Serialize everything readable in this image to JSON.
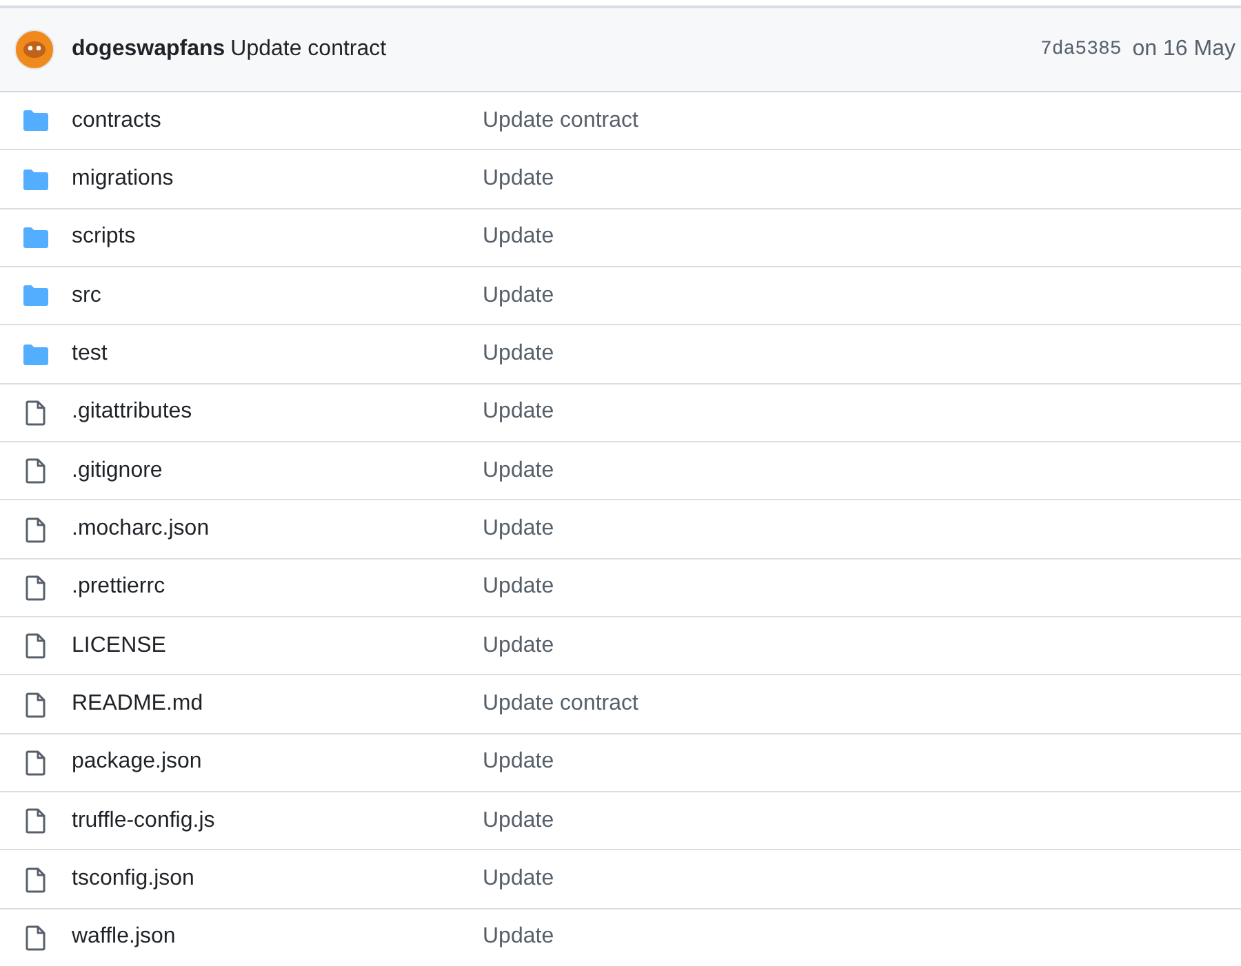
{
  "latest_commit": {
    "author": "dogeswapfans",
    "message": "Update contract",
    "sha": "7da5385",
    "date": "on 16 May"
  },
  "files": [
    {
      "kind": "folder",
      "name": "contracts",
      "message": "Update contract"
    },
    {
      "kind": "folder",
      "name": "migrations",
      "message": "Update"
    },
    {
      "kind": "folder",
      "name": "scripts",
      "message": "Update"
    },
    {
      "kind": "folder",
      "name": "src",
      "message": "Update"
    },
    {
      "kind": "folder",
      "name": "test",
      "message": "Update"
    },
    {
      "kind": "file",
      "name": ".gitattributes",
      "message": "Update"
    },
    {
      "kind": "file",
      "name": ".gitignore",
      "message": "Update"
    },
    {
      "kind": "file",
      "name": ".mocharc.json",
      "message": "Update"
    },
    {
      "kind": "file",
      "name": ".prettierrc",
      "message": "Update"
    },
    {
      "kind": "file",
      "name": "LICENSE",
      "message": "Update"
    },
    {
      "kind": "file",
      "name": "README.md",
      "message": "Update contract"
    },
    {
      "kind": "file",
      "name": "package.json",
      "message": "Update"
    },
    {
      "kind": "file",
      "name": "truffle-config.js",
      "message": "Update"
    },
    {
      "kind": "file",
      "name": "tsconfig.json",
      "message": "Update"
    },
    {
      "kind": "file",
      "name": "waffle.json",
      "message": "Update"
    }
  ]
}
